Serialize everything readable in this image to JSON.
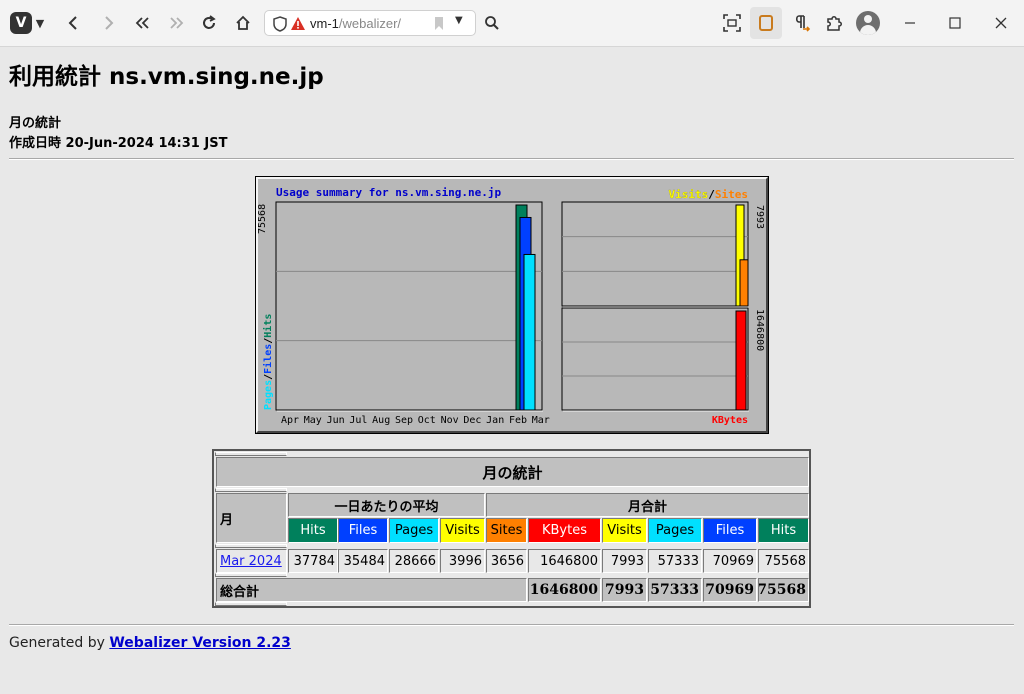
{
  "browser": {
    "url_host": "vm-1",
    "url_path": "/webalizer/"
  },
  "page": {
    "title": "利用統計 ns.vm.sing.ne.jp",
    "subtitle": "月の統計",
    "generated": "作成日時 20-Jun-2024 14:31 JST"
  },
  "chart_data": {
    "type": "bar",
    "title": "Usage summary for ns.vm.sing.ne.jp",
    "categories": [
      "Apr",
      "May",
      "Jun",
      "Jul",
      "Aug",
      "Sep",
      "Oct",
      "Nov",
      "Dec",
      "Jan",
      "Feb",
      "Mar"
    ],
    "left_panel": {
      "max_label": "75568",
      "legend": [
        "Pages",
        "Files",
        "Hits"
      ],
      "series": [
        {
          "name": "Hits",
          "values": [
            0,
            0,
            0,
            0,
            0,
            0,
            0,
            0,
            0,
            0,
            0,
            75568
          ]
        },
        {
          "name": "Files",
          "values": [
            0,
            0,
            0,
            0,
            0,
            0,
            0,
            0,
            0,
            0,
            0,
            70969
          ]
        },
        {
          "name": "Pages",
          "values": [
            0,
            0,
            0,
            0,
            0,
            0,
            0,
            0,
            0,
            0,
            0,
            57333
          ]
        }
      ]
    },
    "right_top_panel": {
      "max_label": "7993",
      "legend": [
        "Visits",
        "Sites"
      ],
      "series": [
        {
          "name": "Visits",
          "values": [
            0,
            0,
            0,
            0,
            0,
            0,
            0,
            0,
            0,
            0,
            0,
            7993
          ]
        },
        {
          "name": "Sites",
          "values": [
            0,
            0,
            0,
            0,
            0,
            0,
            0,
            0,
            0,
            0,
            0,
            3656
          ]
        }
      ]
    },
    "right_bottom_panel": {
      "max_label": "1646800",
      "legend": [
        "KBytes"
      ],
      "series": [
        {
          "name": "KBytes",
          "values": [
            0,
            0,
            0,
            0,
            0,
            0,
            0,
            0,
            0,
            0,
            0,
            1646800
          ]
        }
      ]
    },
    "colors": {
      "Hits": "#00805c",
      "Files": "#0040ff",
      "Pages": "#00e0ff",
      "Visits": "#ffff00",
      "Sites": "#ff8000",
      "KBytes": "#ff0000",
      "title": "#0000cc"
    }
  },
  "table": {
    "title": "月の統計",
    "month_header": "月",
    "avg_header": "一日あたりの平均",
    "total_header": "月合計",
    "avg_cols": [
      "Hits",
      "Files",
      "Pages",
      "Visits"
    ],
    "total_cols": [
      "Sites",
      "KBytes",
      "Visits",
      "Pages",
      "Files",
      "Hits"
    ],
    "rows": [
      {
        "month": "Mar 2024",
        "values": [
          "37784",
          "35484",
          "28666",
          "3996",
          "3656",
          "1646800",
          "7993",
          "57333",
          "70969",
          "75568"
        ]
      }
    ],
    "total_label": "総合計",
    "totals": [
      "1646800",
      "7993",
      "57333",
      "70969",
      "75568"
    ]
  },
  "footer": {
    "prefix": "Generated by",
    "link": "Webalizer Version 2.23"
  }
}
